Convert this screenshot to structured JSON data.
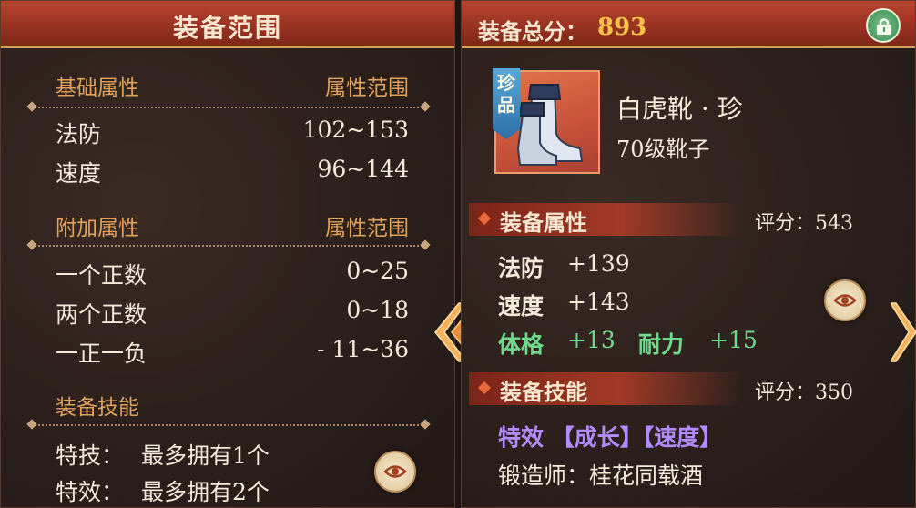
{
  "left_panel": {
    "title": "装备范围",
    "base_attributes": {
      "header_left": "基础属性",
      "header_right": "属性范围",
      "rows": [
        {
          "name": "法防",
          "range": "102~153"
        },
        {
          "name": "速度",
          "range": "96~144"
        }
      ]
    },
    "extra_attributes": {
      "header_left": "附加属性",
      "header_right": "属性范围",
      "rows": [
        {
          "name": "一个正数",
          "range": "0~25"
        },
        {
          "name": "两个正数",
          "range": "0~18"
        },
        {
          "name": "一正一负",
          "range": "- 11~36"
        }
      ]
    },
    "skills": {
      "header": "装备技能",
      "rows": [
        {
          "label": "特技：",
          "value": "最多拥有1个"
        },
        {
          "label": "特效：",
          "value": "最多拥有2个"
        }
      ]
    }
  },
  "right_panel": {
    "score_label": "装备总分：",
    "score_value": "893",
    "item": {
      "rarity": "珍品",
      "name": "白虎靴 · 珍",
      "level_type": "70级靴子"
    },
    "attributes_section": {
      "title": "装备属性",
      "score": "评分：543",
      "stats": [
        {
          "name": "法防",
          "value": "+139"
        },
        {
          "name": "速度",
          "value": "+143"
        }
      ],
      "bonus_stats": [
        {
          "name": "体格",
          "value": "+13"
        },
        {
          "name": "耐力",
          "value": "+15"
        }
      ]
    },
    "skills_section": {
      "title": "装备技能",
      "score": "评分：350",
      "effect": "特效 【成长】【速度】",
      "forger": "锻造师：桂花同载酒"
    }
  },
  "colors": {
    "header_red": "#9a3322",
    "section_orange": "#e1a25c",
    "score_gold": "#f6c24a",
    "stat_green": "#6fd98d",
    "effect_purple": "#b38cff"
  },
  "icons": [
    "eye-icon",
    "lock-icon",
    "boots-icon",
    "chevron-left-icon",
    "chevron-right-icon"
  ]
}
